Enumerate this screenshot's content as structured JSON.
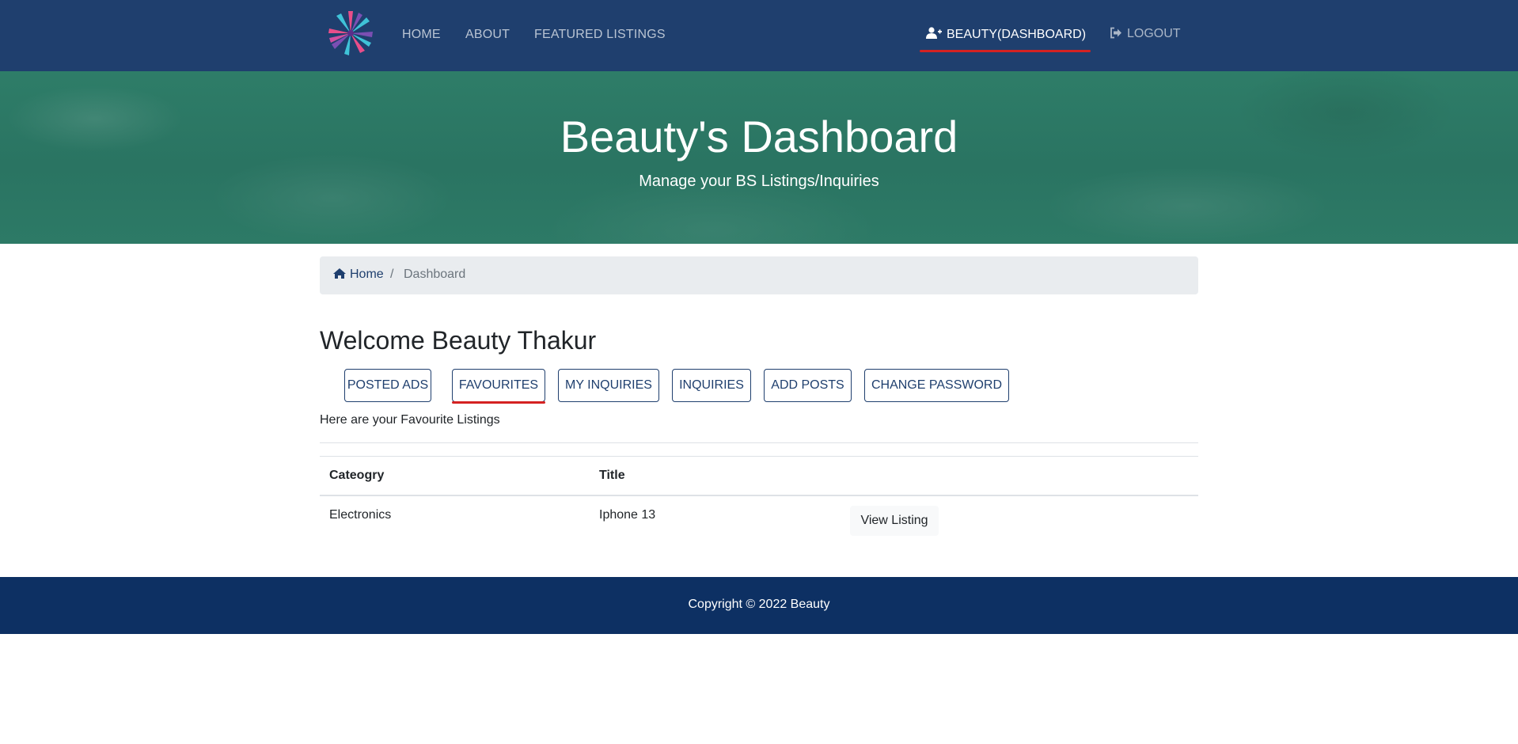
{
  "navbar": {
    "logo": "logo-icon",
    "links": {
      "home": "HOME",
      "about": "ABOUT",
      "featured": "FEATURED LISTINGS"
    },
    "dashboard_label": "BEAUTY(DASHBOARD)",
    "dashboard_icon": "user-plus-icon",
    "logout_label": "LOGOUT",
    "logout_icon": "sign-out-icon",
    "accent_color": "#d42222",
    "bg_color": "#1f3f6e"
  },
  "hero": {
    "title": "Beauty's Dashboard",
    "subtitle": "Manage your BS Listings/Inquiries"
  },
  "breadcrumb": {
    "home_label": "Home",
    "home_icon": "home-icon",
    "separator": "/",
    "current": "Dashboard"
  },
  "main": {
    "welcome": "Welcome Beauty Thakur",
    "tabs": [
      {
        "label": "POSTED ADS"
      },
      {
        "label": "FAVOURITES",
        "active": true
      },
      {
        "label": "MY INQUIRIES"
      },
      {
        "label": "INQUIRIES"
      },
      {
        "label": "ADD POSTS"
      },
      {
        "label": "CHANGE PASSWORD"
      }
    ],
    "intro_text": "Here are your Favourite Listings"
  },
  "table": {
    "headers": [
      "Cateogry",
      "Title",
      ""
    ],
    "rows": [
      {
        "category": "Electronics",
        "title": "Iphone 13",
        "action": "View Listing"
      }
    ]
  },
  "footer": {
    "text": "Copyright © 2022 Beauty",
    "bg_color": "#0d3063"
  }
}
